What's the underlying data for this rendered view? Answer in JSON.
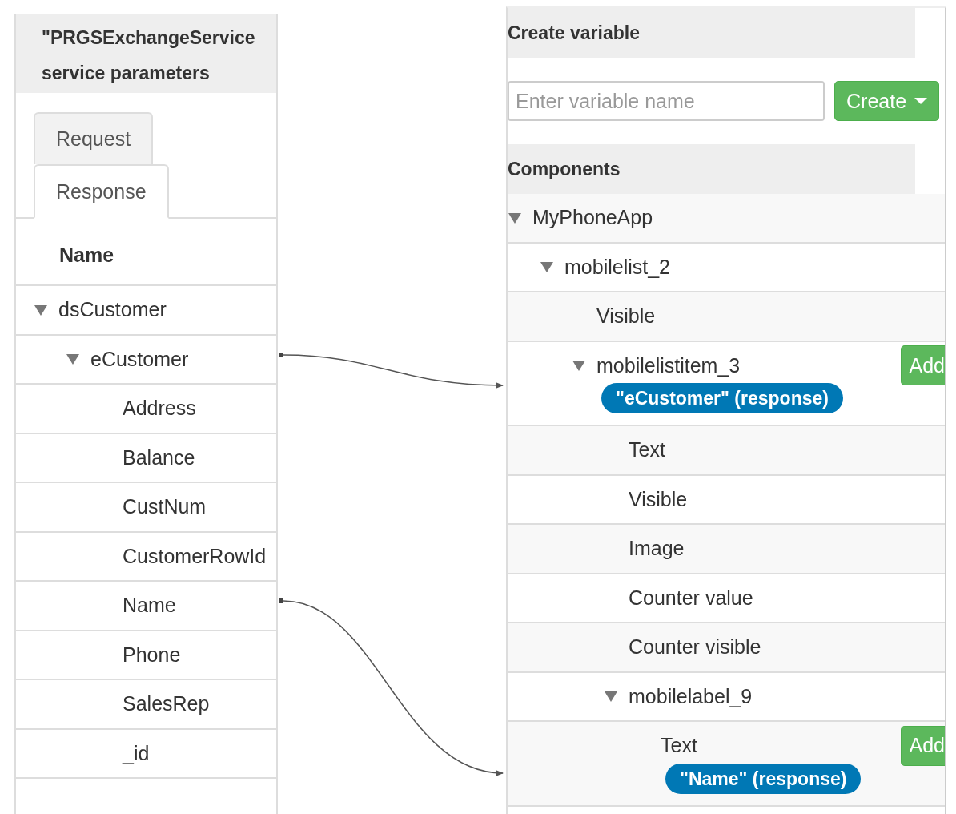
{
  "left_panel": {
    "title_lines": [
      "\"PRGSExchangeService",
      "service parameters"
    ],
    "tabs": [
      {
        "label": "Request",
        "selected": false
      },
      {
        "label": "Response",
        "selected": true
      }
    ],
    "column_header": "Name",
    "tree": [
      {
        "label": "dsCustomer",
        "expanded": true,
        "children": [
          {
            "label": "eCustomer",
            "expanded": true,
            "children": [
              {
                "label": "Address"
              },
              {
                "label": "Balance"
              },
              {
                "label": "CustNum"
              },
              {
                "label": "CustomerRowId"
              },
              {
                "label": "Name"
              },
              {
                "label": "Phone"
              },
              {
                "label": "SalesRep"
              },
              {
                "label": "_id"
              }
            ]
          }
        ]
      }
    ]
  },
  "right_panel": {
    "create_title": "Create variable",
    "variable_field": {
      "placeholder": "Enter variable name"
    },
    "create_button": "Create",
    "components_title": "Components",
    "tree": [
      {
        "label": "MyPhoneApp",
        "expanded": true,
        "children": [
          {
            "label": "mobilelist_2",
            "expanded": true,
            "children": [
              {
                "label": "Visible"
              },
              {
                "label": "mobilelistitem_3",
                "expanded": true,
                "binding": "\"eCustomer\" (response)",
                "action": "Add",
                "children": [
                  {
                    "label": "Text"
                  },
                  {
                    "label": "Visible"
                  },
                  {
                    "label": "Image"
                  },
                  {
                    "label": "Counter value"
                  },
                  {
                    "label": "Counter visible"
                  },
                  {
                    "label": "mobilelabel_9",
                    "expanded": true,
                    "children": [
                      {
                        "label": "Text",
                        "binding": "\"Name\" (response)",
                        "action": "Add"
                      }
                    ]
                  }
                ]
              }
            ]
          }
        ]
      }
    ]
  }
}
